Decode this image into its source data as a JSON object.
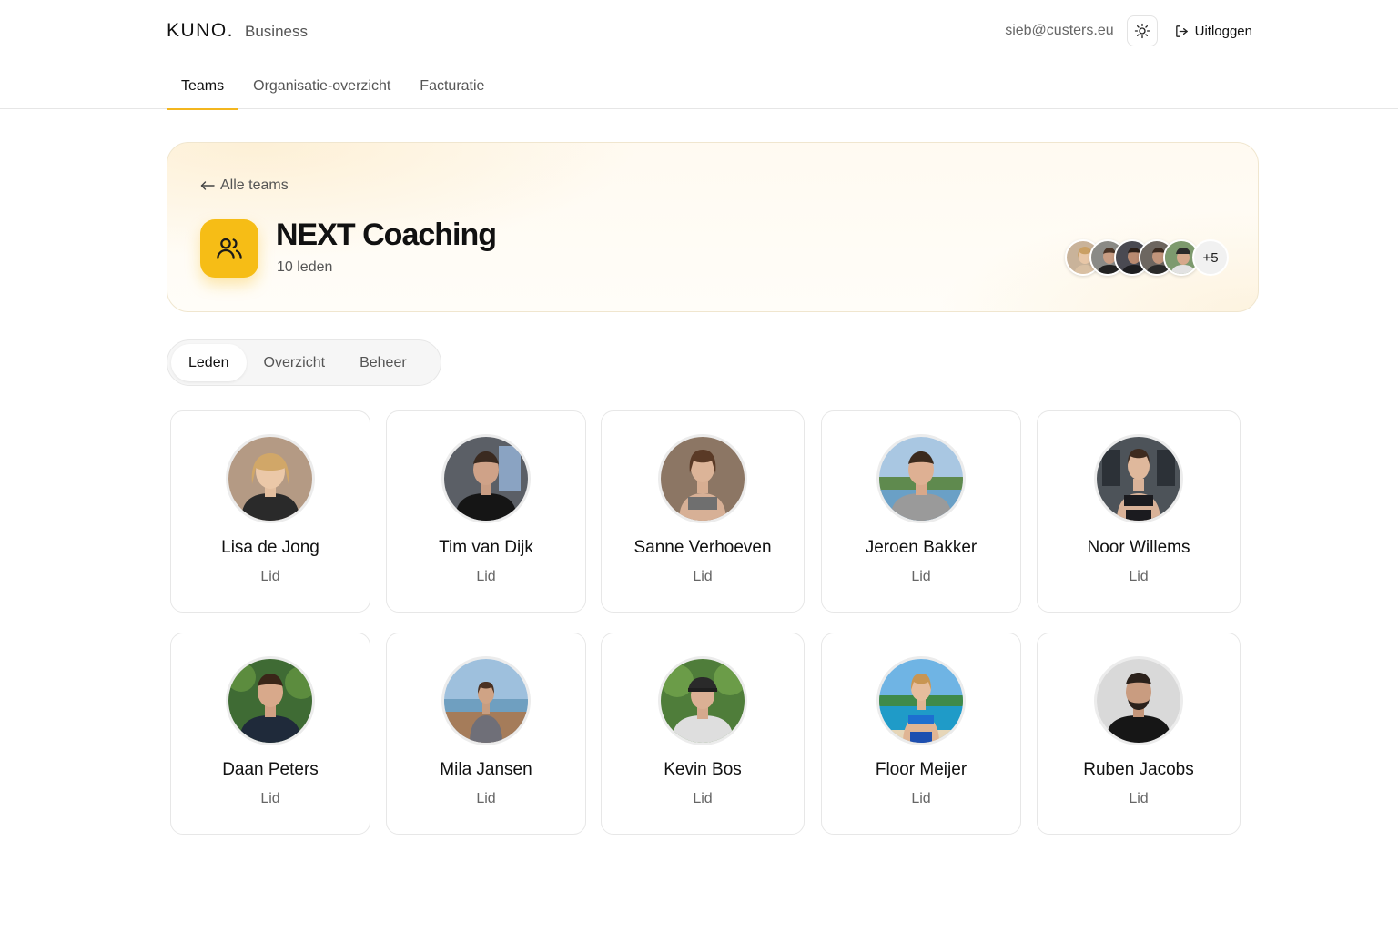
{
  "header": {
    "logo": "KUNO.",
    "logo_sub": "Business",
    "email": "sieb@custers.eu",
    "logout_label": "Uitloggen"
  },
  "nav": {
    "tabs": [
      {
        "label": "Teams",
        "active": true
      },
      {
        "label": "Organisatie-overzicht",
        "active": false
      },
      {
        "label": "Facturatie",
        "active": false
      }
    ]
  },
  "team": {
    "back_label": "Alle teams",
    "name": "NEXT Coaching",
    "member_count": "10 leden",
    "extra_avatars": "+5"
  },
  "subtabs": [
    {
      "label": "Leden",
      "active": true
    },
    {
      "label": "Overzicht",
      "active": false
    },
    {
      "label": "Beheer",
      "active": false
    }
  ],
  "members": [
    {
      "name": "Lisa de Jong",
      "role": "Lid"
    },
    {
      "name": "Tim van Dijk",
      "role": "Lid"
    },
    {
      "name": "Sanne Verhoeven",
      "role": "Lid"
    },
    {
      "name": "Jeroen Bakker",
      "role": "Lid"
    },
    {
      "name": "Noor Willems",
      "role": "Lid"
    },
    {
      "name": "Daan Peters",
      "role": "Lid"
    },
    {
      "name": "Mila Jansen",
      "role": "Lid"
    },
    {
      "name": "Kevin Bos",
      "role": "Lid"
    },
    {
      "name": "Floor Meijer",
      "role": "Lid"
    },
    {
      "name": "Ruben Jacobs",
      "role": "Lid"
    }
  ],
  "colors": {
    "accent": "#f3b61f",
    "team_icon_bg": "#f6bd16"
  }
}
